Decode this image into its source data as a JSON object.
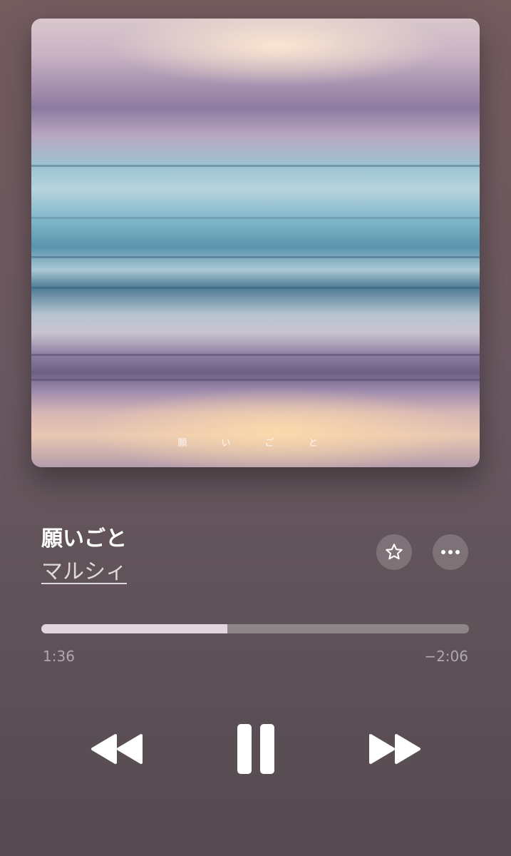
{
  "album": {
    "caption": "願 い ご と"
  },
  "track": {
    "title": "願いごと",
    "artist": "マルシィ"
  },
  "playback": {
    "elapsed": "1:36",
    "remaining": "−2:06",
    "progress_fraction": 0.435,
    "state": "playing"
  },
  "buttons": {
    "favorite_icon": "star-icon",
    "more_icon": "ellipsis-icon",
    "rewind_icon": "rewind-icon",
    "pause_icon": "pause-icon",
    "forward_icon": "fast-forward-icon"
  },
  "colors": {
    "progress_fill": "#ede2ea",
    "progress_track": "#8f8289"
  }
}
